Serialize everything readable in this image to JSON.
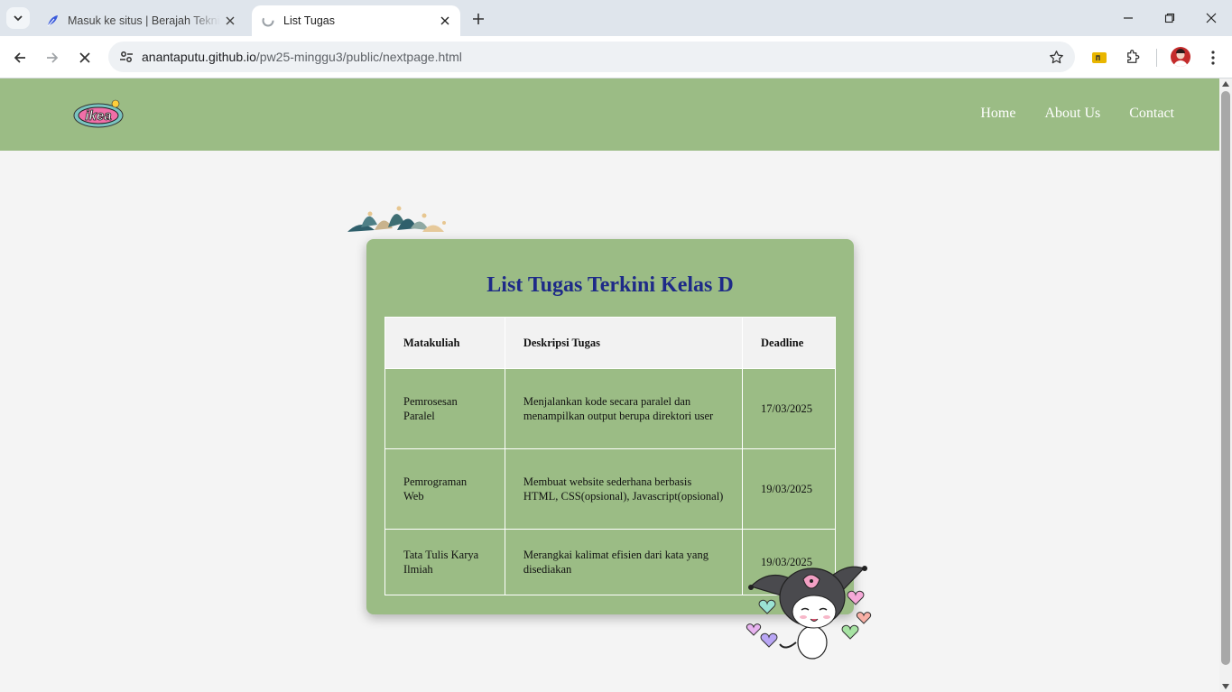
{
  "browser": {
    "tabs": [
      {
        "title": "Masuk ke situs | Berajah Teknik",
        "active": false,
        "favicon": "feather-icon"
      },
      {
        "title": "List Tugas",
        "active": true,
        "favicon": "loading-icon"
      }
    ],
    "address": {
      "host": "anantaputu.github.io",
      "path": "/pw25-minggu3/public/nextpage.html"
    }
  },
  "site": {
    "logo_text": "ikea",
    "nav": [
      "Home",
      "About Us",
      "Contact"
    ]
  },
  "content": {
    "title": "List Tugas Terkini Kelas D",
    "table": {
      "headers": [
        "Matakuliah",
        "Deskripsi Tugas",
        "Deadline"
      ],
      "rows": [
        {
          "course": "Pemrosesan Paralel",
          "desc": "Menjalankan kode secara paralel dan menampilkan output berupa direktori user",
          "deadline": "17/03/2025"
        },
        {
          "course": "Pemrograman Web",
          "desc": "Membuat website sederhana berbasis HTML, CSS(opsional), Javascript(opsional)",
          "deadline": "19/03/2025"
        },
        {
          "course": "Tata Tulis Karya Ilmiah",
          "desc": "Merangkai kalimat efisien dari kata yang disediakan",
          "deadline": "19/03/2025"
        }
      ]
    }
  },
  "colors": {
    "header": "#9bbc85",
    "title": "#1e2a88",
    "background": "#f4f4f4"
  }
}
